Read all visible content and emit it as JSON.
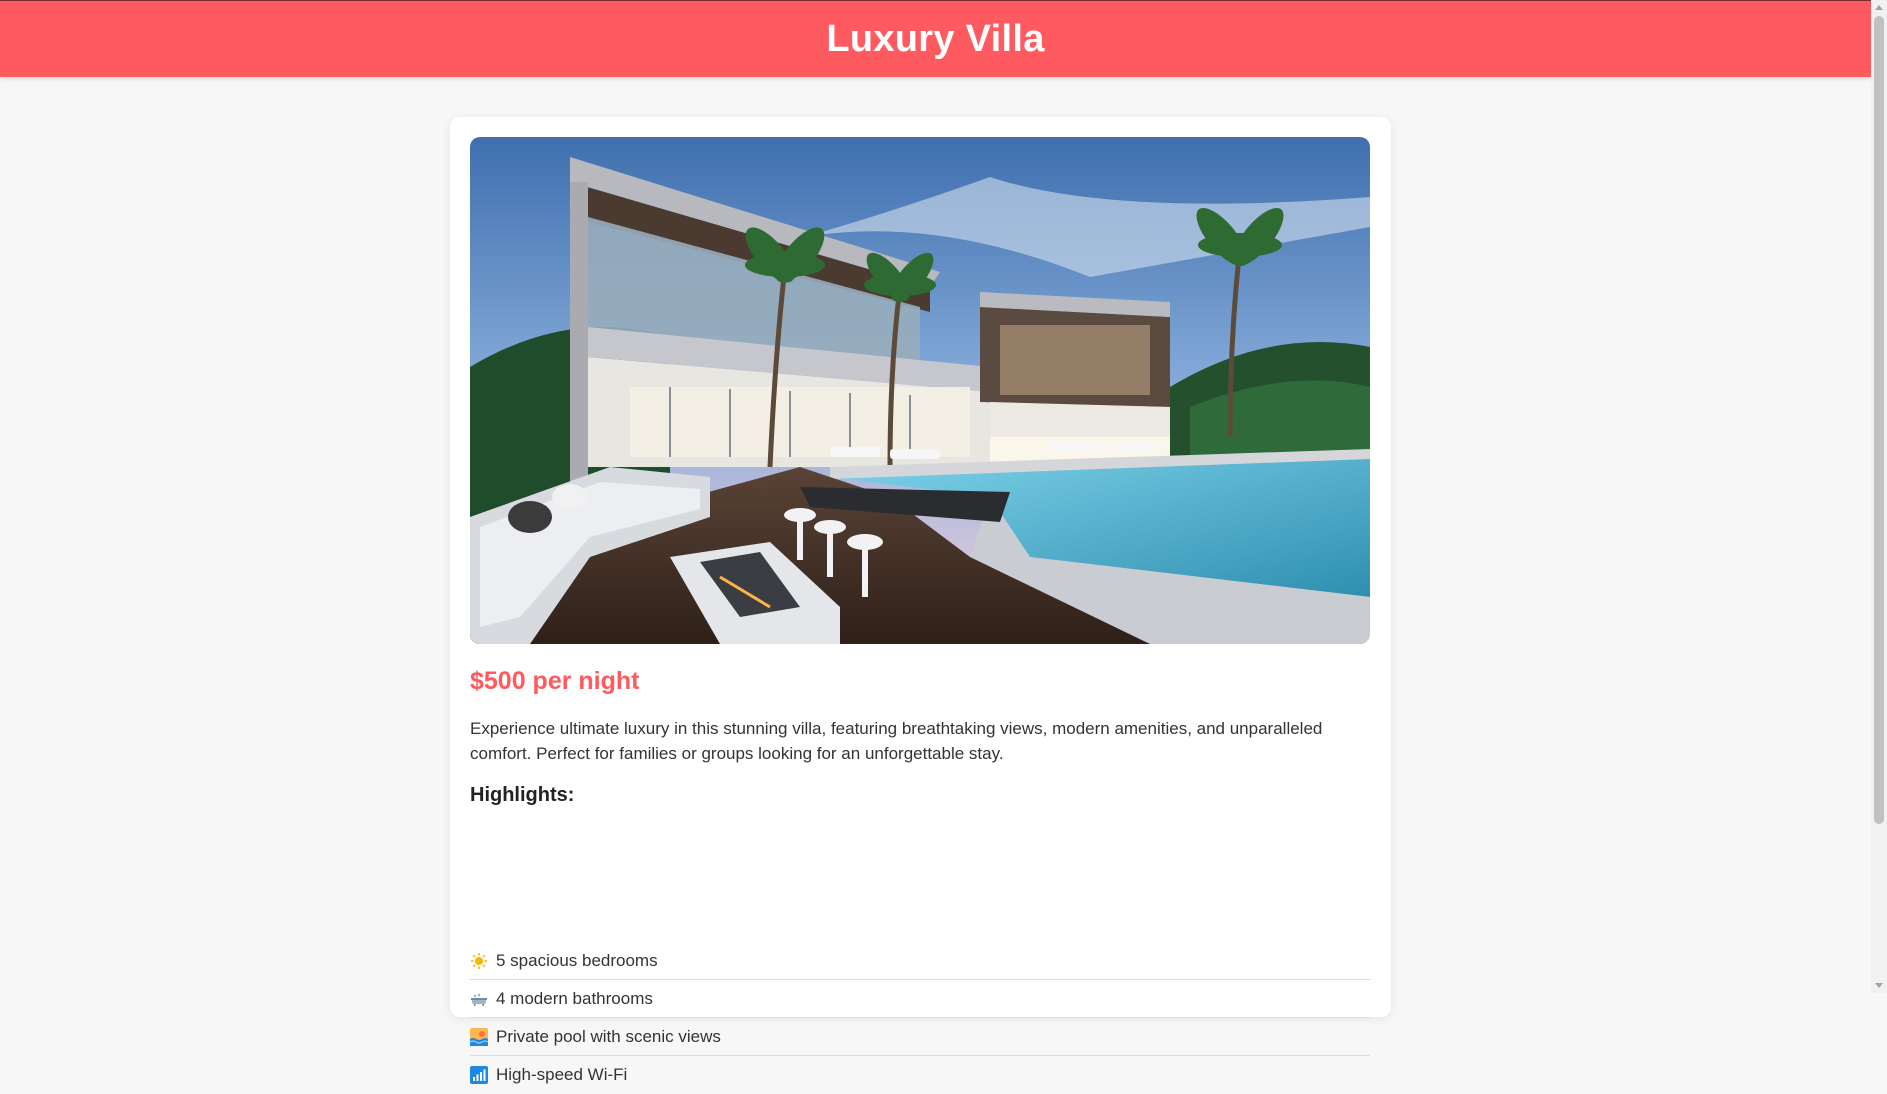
{
  "header": {
    "title": "Luxury Villa"
  },
  "listing": {
    "photo_alt": "Luxury villa with infinity pool",
    "price": "$500 per night",
    "description": "Experience ultimate luxury in this stunning villa, featuring breathtaking views, modern amenities, and unparalleled comfort. Perfect for families or groups looking for an unforgettable stay.",
    "highlights_title": "Highlights:",
    "highlights": [
      {
        "icon": "sun-icon",
        "label": "5 spacious bedrooms"
      },
      {
        "icon": "bathtub-icon",
        "label": "4 modern bathrooms"
      },
      {
        "icon": "pool-icon",
        "label": "Private pool with scenic views"
      },
      {
        "icon": "wifi-signal-icon",
        "label": "High-speed Wi-Fi"
      }
    ]
  },
  "colors": {
    "brand": "#ff5a5f",
    "background": "#f7f7f7",
    "card": "#ffffff"
  }
}
